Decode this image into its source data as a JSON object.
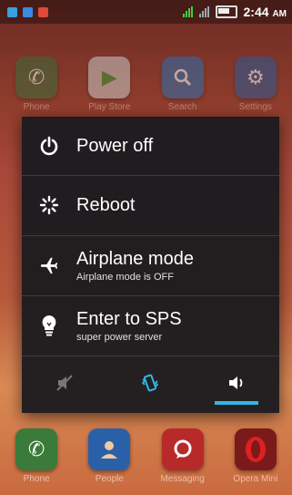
{
  "status_bar": {
    "time": "2:44",
    "ampm": "AM"
  },
  "home_row_top": [
    {
      "label": "Phone",
      "icon": "phone-icon",
      "color": "#3a6b3a"
    },
    {
      "label": "Play Store",
      "icon": "play-store-icon",
      "color": "#c8c8c8"
    },
    {
      "label": "Search",
      "icon": "search-icon",
      "color": "#2a6fb0"
    },
    {
      "label": "Settings",
      "icon": "settings-icon",
      "color": "#2a5a9a"
    }
  ],
  "dock": [
    {
      "label": "Phone",
      "icon": "phone-icon",
      "color": "#3a7a3a"
    },
    {
      "label": "People",
      "icon": "people-icon",
      "color": "#2a60a8"
    },
    {
      "label": "Messaging",
      "icon": "messaging-icon",
      "color": "#b82a2a"
    },
    {
      "label": "Opera Mini",
      "icon": "opera-icon",
      "color": "#c02020"
    }
  ],
  "power_menu": {
    "items": [
      {
        "title": "Power off",
        "subtitle": "",
        "icon": "power-icon"
      },
      {
        "title": "Reboot",
        "subtitle": "",
        "icon": "reboot-icon"
      },
      {
        "title": "Airplane mode",
        "subtitle": "Airplane mode is OFF",
        "icon": "airplane-icon"
      },
      {
        "title": "Enter to SPS",
        "subtitle": "super power server",
        "icon": "bulb-icon"
      }
    ],
    "sound_modes": [
      {
        "name": "silent",
        "icon": "silent-icon"
      },
      {
        "name": "vibrate",
        "icon": "vibrate-icon"
      },
      {
        "name": "sound-on",
        "icon": "volume-icon",
        "selected": true
      }
    ],
    "accent_color": "#33b5e5"
  }
}
